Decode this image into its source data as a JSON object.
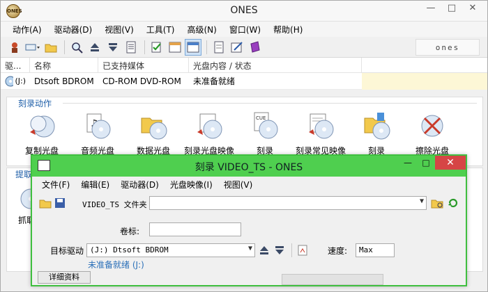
{
  "main": {
    "title": "ONES",
    "menu": [
      "动作(A)",
      "驱动器(D)",
      "视图(V)",
      "工具(T)",
      "高级(N)",
      "窗口(W)",
      "帮助(H)"
    ],
    "brand_box": "onеs",
    "list": {
      "headers": [
        "驱...",
        "名称",
        "已支持媒体",
        "光盘内容 / 状态"
      ],
      "row": {
        "drive": "(J:)",
        "name": "Dtsoft BDROM",
        "media": "CD-ROM DVD-ROM",
        "status": "未准备就绪"
      }
    },
    "burn_section": {
      "title": "刻录动作",
      "actions": [
        "复制光盘",
        "音频光盘",
        "数据光盘",
        "刻录光盘映像",
        "刻录",
        "刻录常见映像",
        "刻录",
        "擦除光盘"
      ]
    },
    "extract_section": {
      "title": "提取",
      "item_label": "抓取"
    }
  },
  "dialog": {
    "title": "刻录 VIDEO_TS - ONES",
    "menu": [
      "文件(F)",
      "编辑(E)",
      "驱动器(D)",
      "光盘映像(I)",
      "视图(V)"
    ],
    "folder_label": "VIDEO_TS 文件夹",
    "folder_value": "",
    "volume_label": "卷标:",
    "volume_value": "",
    "target_label": "目标驱动",
    "target_value": "(J:) Dtsoft BDROM",
    "status": "未准备就绪 (J:)",
    "speed_label": "速度:",
    "speed_value": "Max",
    "details_button": "详细资料"
  },
  "colors": {
    "dialog_title_green": "#4fcf4f",
    "close_red": "#d64545",
    "section_title_blue": "#1f5fa8"
  }
}
